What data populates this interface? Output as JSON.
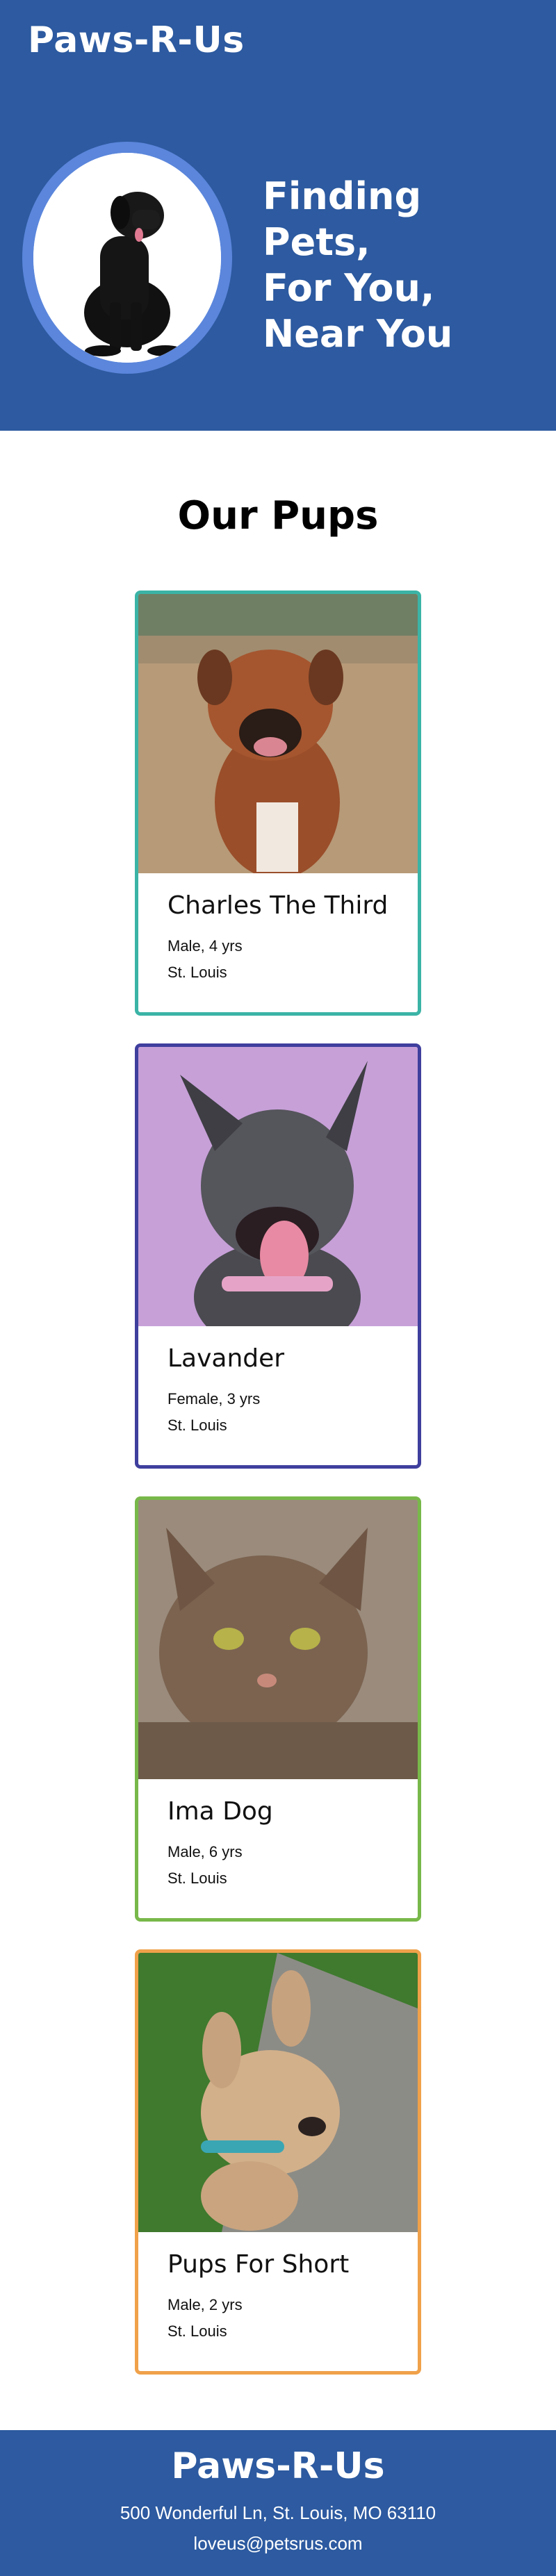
{
  "header": {
    "brand": "Paws-R-Us",
    "tagline": [
      "Finding Pets,",
      "For You,",
      "Near You"
    ]
  },
  "section": {
    "title": "Our Pups"
  },
  "pets": [
    {
      "name": "Charles The Third",
      "details": "Male, 4 yrs",
      "location": "St. Louis",
      "border_color": "#3bb4a6",
      "photo": "brown-boxer-dog-photo"
    },
    {
      "name": "Lavander",
      "details": "Female, 3 yrs",
      "location": "St. Louis",
      "border_color": "#3f3f9e",
      "photo": "gray-pitbull-dog-photo"
    },
    {
      "name": "Ima Dog",
      "details": "Male, 6 yrs",
      "location": "St. Louis",
      "border_color": "#78b84a",
      "photo": "tabby-cat-photo"
    },
    {
      "name": "Pups For Short",
      "details": "Male, 2 yrs",
      "location": "St. Louis",
      "border_color": "#f0a14a",
      "photo": "tan-puppy-photo"
    }
  ],
  "footer": {
    "brand": "Paws-R-Us",
    "address": "500 Wonderful Ln, St. Louis, MO 63110",
    "email": "loveus@petsrus.com"
  },
  "colors": {
    "primary": "#2d5aa0",
    "ring": "#5b86dc"
  }
}
